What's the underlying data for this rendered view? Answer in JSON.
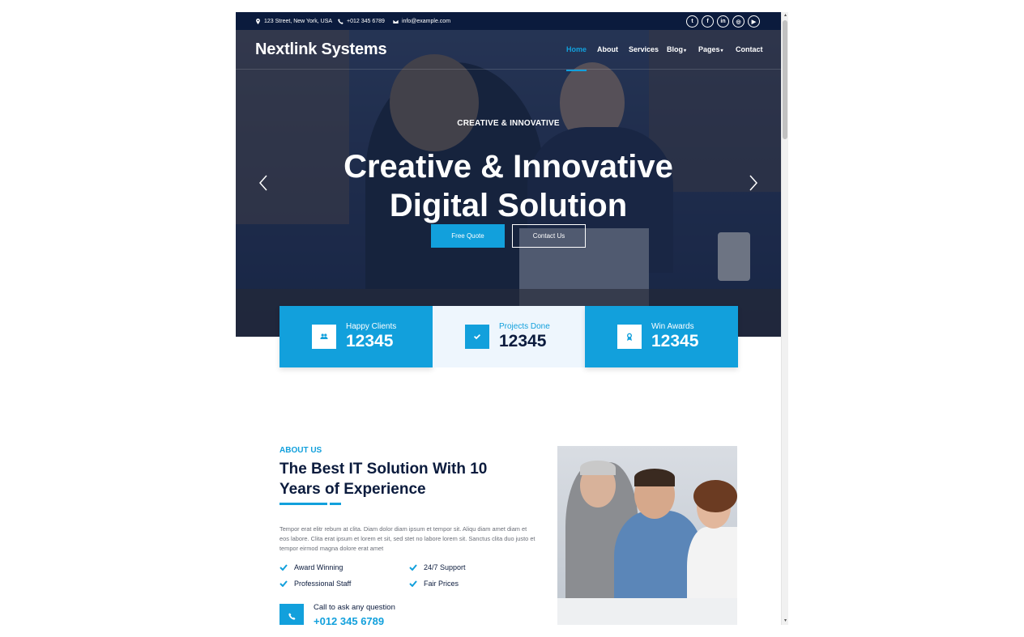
{
  "topbar": {
    "address": "123 Street, New York, USA",
    "phone": "+012 345 6789",
    "email": "info@example.com",
    "social": [
      {
        "icon": "twitter-icon",
        "glyph": "t"
      },
      {
        "icon": "facebook-icon",
        "glyph": "f"
      },
      {
        "icon": "linkedin-icon",
        "glyph": "in"
      },
      {
        "icon": "instagram-icon",
        "glyph": "◎"
      },
      {
        "icon": "youtube-icon",
        "glyph": "▶"
      }
    ]
  },
  "navbar": {
    "brand": "Nextlink Systems",
    "items": [
      {
        "label": "Home",
        "active": true
      },
      {
        "label": "About"
      },
      {
        "label": "Services"
      },
      {
        "label": "Blog",
        "dropdown": true
      },
      {
        "label": "Pages",
        "dropdown": true
      },
      {
        "label": "Contact"
      }
    ]
  },
  "hero": {
    "subtitle": "CREATIVE & INNOVATIVE",
    "title_line1": "Creative & Innovative",
    "title_line2": "Digital Solution",
    "btn_quote": "Free Quote",
    "btn_contact": "Contact Us"
  },
  "stats": [
    {
      "label": "Happy Clients",
      "value": "12345",
      "icon": "users-icon"
    },
    {
      "label": "Projects Done",
      "value": "12345",
      "icon": "check-icon"
    },
    {
      "label": "Win Awards",
      "value": "12345",
      "icon": "award-icon"
    }
  ],
  "about": {
    "label": "ABOUT US",
    "title": "The Best IT Solution With 10 Years of Experience",
    "text": "Tempor erat elitr rebum at clita. Diam dolor diam ipsum et tempor sit. Aliqu diam amet diam et eos labore. Clita erat ipsum et lorem et sit, sed stet no labore lorem sit. Sanctus clita duo justo et tempor eirmod magna dolore erat amet",
    "features": [
      "Award Winning",
      "24/7 Support",
      "Professional Staff",
      "Fair Prices"
    ],
    "call_label": "Call to ask any question",
    "call_number": "+012 345 6789"
  },
  "colors": {
    "primary": "#12a0dc",
    "dark": "#0b1b3d",
    "light": "#eef6fd"
  }
}
